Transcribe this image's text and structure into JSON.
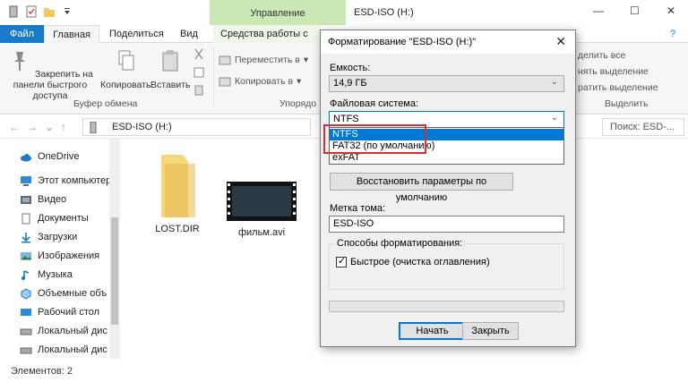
{
  "window": {
    "manage_tab": "Управление",
    "title": "ESD-ISO (H:)",
    "minimize": "—",
    "maximize": "☐",
    "close": "✕"
  },
  "ribbon_tabs": {
    "file": "Файл",
    "home": "Главная",
    "share": "Поделиться",
    "view": "Вид",
    "drive_tools": "Средства работы с диском",
    "help": "?"
  },
  "ribbon": {
    "pin": "Закрепить на панели быстрого доступа",
    "copy": "Копировать",
    "paste": "Вставить",
    "clipboard_group": "Буфер обмена",
    "move_to": "Переместить в",
    "copy_to": "Копировать в",
    "organize_group": "Упорядо",
    "select_all": "делить все",
    "select_none": "нять выделение",
    "invert_selection": "ратить выделение",
    "select_group": "Выделить"
  },
  "address": {
    "path": "ESD-ISO (H:)",
    "search_placeholder": "Поиск: ESD-..."
  },
  "nav": {
    "items": [
      {
        "label": "OneDrive",
        "icon": "cloud-icon"
      },
      {
        "label": "Этот компьютер",
        "icon": "computer-icon"
      },
      {
        "label": "Видео",
        "icon": "video-folder-icon"
      },
      {
        "label": "Документы",
        "icon": "documents-folder-icon"
      },
      {
        "label": "Загрузки",
        "icon": "downloads-folder-icon"
      },
      {
        "label": "Изображения",
        "icon": "pictures-folder-icon"
      },
      {
        "label": "Музыка",
        "icon": "music-folder-icon"
      },
      {
        "label": "Объемные объ",
        "icon": "3d-objects-folder-icon"
      },
      {
        "label": "Рабочий стол",
        "icon": "desktop-folder-icon"
      },
      {
        "label": "Локальный дис",
        "icon": "drive-icon"
      },
      {
        "label": "Локальный дис",
        "icon": "drive-icon"
      }
    ]
  },
  "files": [
    {
      "name": "LOST.DIR",
      "icon": "folder-icon"
    },
    {
      "name": "фильм.avi",
      "icon": "video-file-icon"
    }
  ],
  "status": {
    "items_count": "Элементов: 2"
  },
  "dialog": {
    "title": "Форматирование \"ESD-ISO (H:)\"",
    "capacity_label": "Емкость:",
    "capacity_value": "14,9 ГБ",
    "fs_label": "Файловая система:",
    "fs_value": "NTFS",
    "fs_options": [
      "NTFS",
      "FAT32 (по умолчанию)",
      "exFAT"
    ],
    "restore_defaults": "Восстановить параметры по умолчанию",
    "volume_label": "Метка тома:",
    "volume_value": "ESD-ISO",
    "format_options_label": "Способы форматирования:",
    "quick_format": "Быстрое (очистка оглавления)",
    "quick_format_checked": true,
    "start": "Начать",
    "close": "Закрыть"
  },
  "colors": {
    "accent": "#0078d7",
    "file_tab": "#1979ca",
    "manage_tab": "#c9e8b6",
    "highlight_frame": "#d63030"
  }
}
